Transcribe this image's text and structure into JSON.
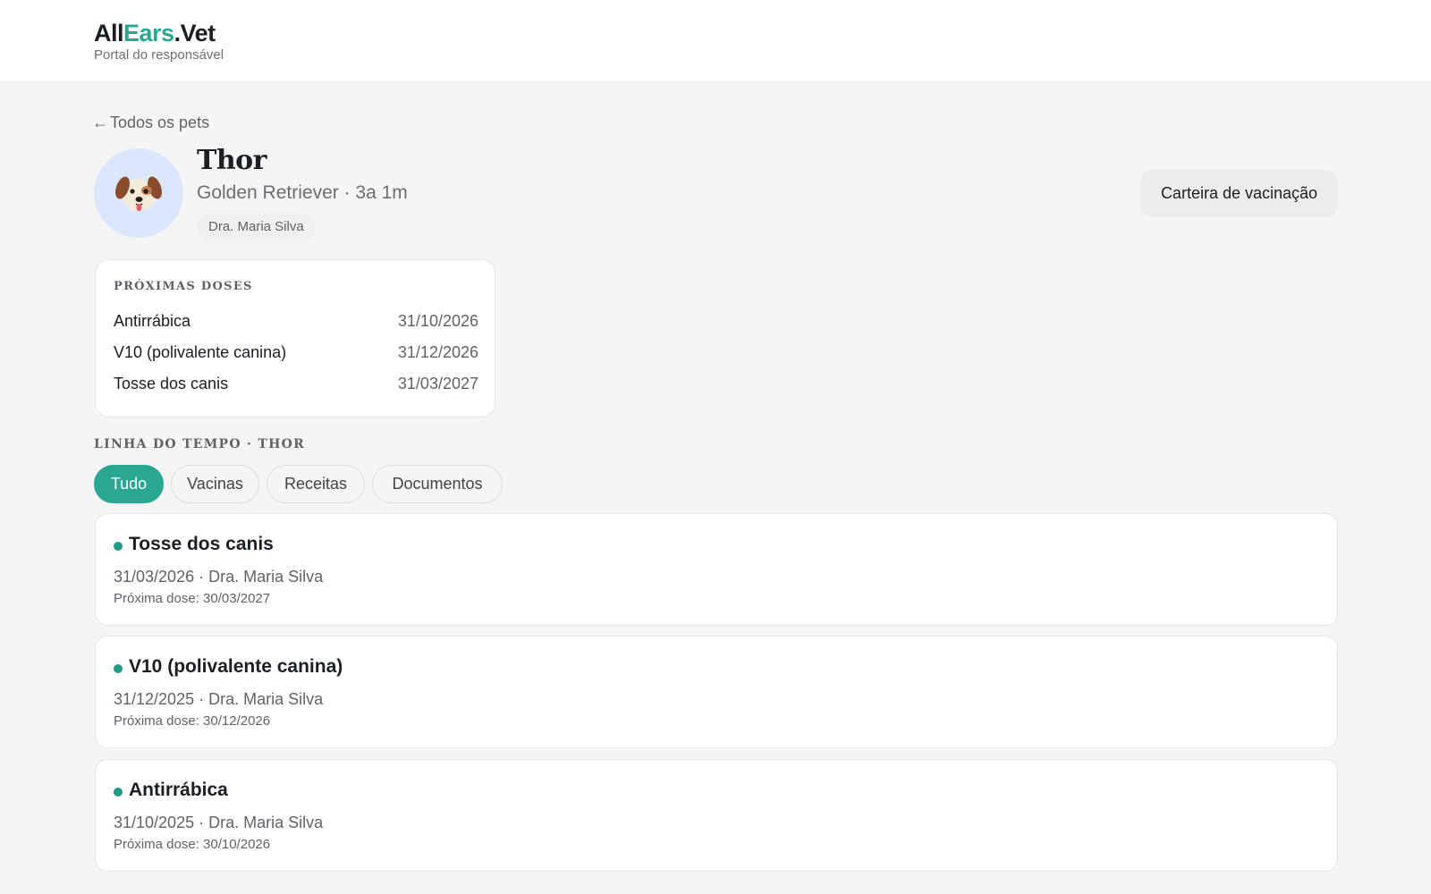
{
  "header": {
    "brand_all": "All",
    "brand_ears": "Ears",
    "brand_vet": ".Vet",
    "subtitle": "Portal do responsável"
  },
  "nav": {
    "back_arrow": "←",
    "back_label": "Todos os pets"
  },
  "pet": {
    "avatar_icon": "dog-face-icon",
    "name": "Thor",
    "meta": "Golden Retriever · 3a 1m",
    "vet": "Dra. Maria Silva",
    "vaccination_button": "Carteira de vacinação"
  },
  "doses": {
    "title": "PRÓXIMAS DOSES",
    "items": [
      {
        "name": "Antirrábica",
        "date": "31/10/2026"
      },
      {
        "name": "V10 (polivalente canina)",
        "date": "31/12/2026"
      },
      {
        "name": "Tosse dos canis",
        "date": "31/03/2027"
      }
    ]
  },
  "timeline": {
    "title": "LINHA DO TEMPO · THOR",
    "tabs": [
      {
        "label": "Tudo",
        "active": true
      },
      {
        "label": "Vacinas",
        "active": false
      },
      {
        "label": "Receitas",
        "active": false
      },
      {
        "label": "Documentos",
        "active": false
      }
    ],
    "entries": [
      {
        "title": "Tosse dos canis",
        "date_vet": "31/03/2026 · Dra. Maria Silva",
        "next_dose": "Próxima dose: 30/03/2027"
      },
      {
        "title": "V10 (polivalente canina)",
        "date_vet": "31/12/2025 · Dra. Maria Silva",
        "next_dose": "Próxima dose: 30/12/2026"
      },
      {
        "title": "Antirrábica",
        "date_vet": "31/10/2025 · Dra. Maria Silva",
        "next_dose": "Próxima dose: 30/10/2026"
      }
    ]
  },
  "colors": {
    "accent": "#2aa793",
    "dot": "#1f9a86",
    "avatar_bg": "#dbe8fb",
    "page_bg": "#f5f5f5"
  }
}
